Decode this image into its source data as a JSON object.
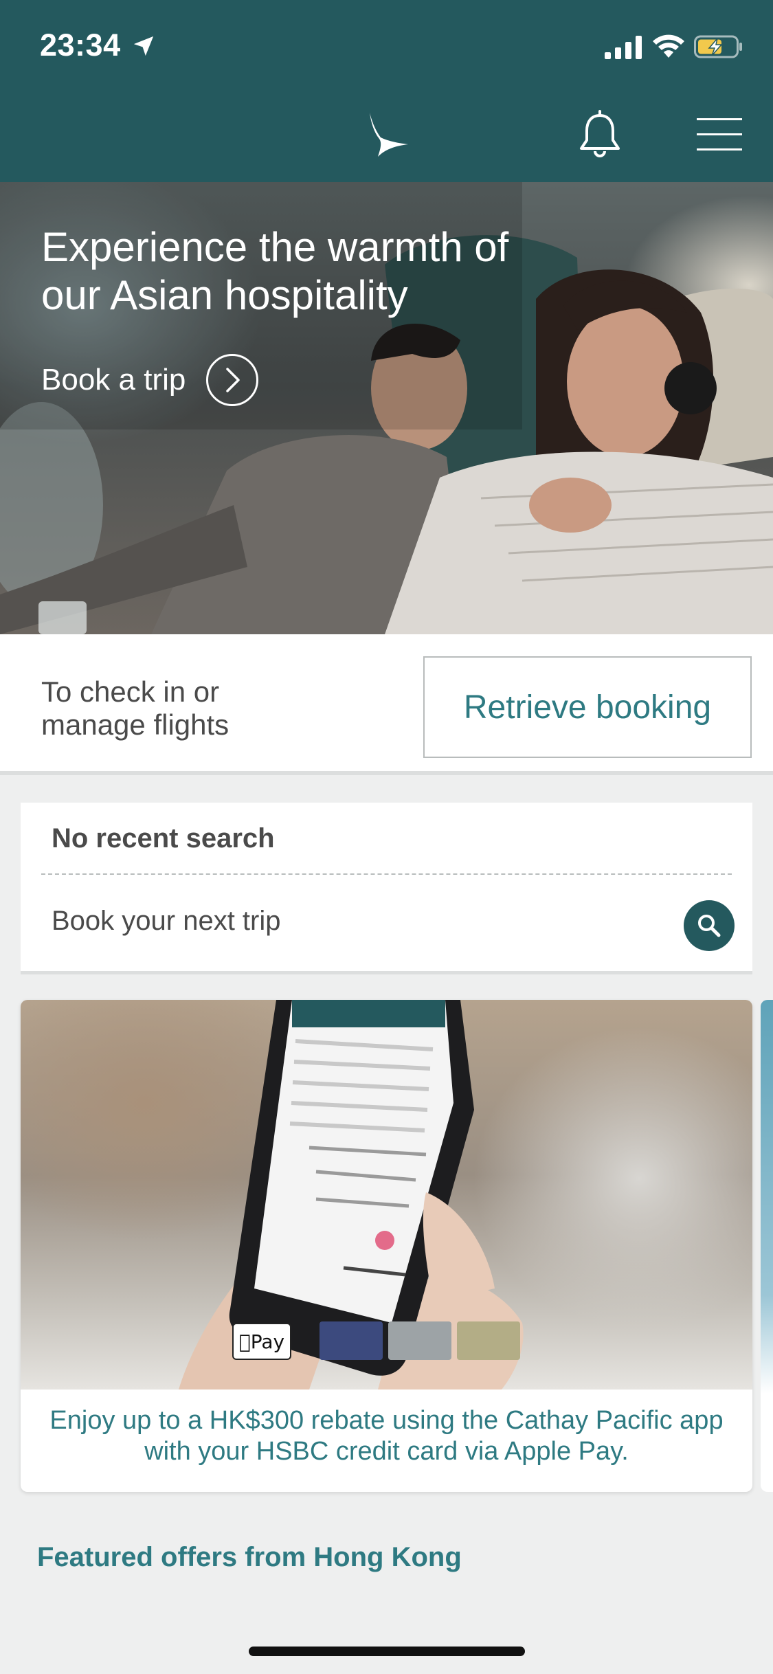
{
  "status_bar": {
    "time": "23:34",
    "icons": [
      "location-arrow-icon",
      "cellular-signal-icon",
      "wifi-icon",
      "battery-charging-icon"
    ]
  },
  "nav": {
    "logo": "cathay-brushwing-logo",
    "icons": [
      "bell-icon",
      "hamburger-menu-icon"
    ],
    "bar_color": "#24595e"
  },
  "hero": {
    "title": "Experience the warmth of our Asian hospitality",
    "cta_label": "Book a trip",
    "cta_icon": "chevron-right-circle-icon"
  },
  "manage": {
    "text": "To check in or manage flights",
    "button_label": "Retrieve booking"
  },
  "search": {
    "recent_label": "No recent search",
    "next_trip_label": "Book your next trip",
    "search_icon": "search-icon"
  },
  "promo": {
    "badge": "Pay",
    "text": "Enjoy up to a HK$300 rebate using the Cathay Pacific app with your HSBC credit card via Apple Pay.",
    "accent": "#2e7a82"
  },
  "featured": {
    "title": "Featured offers from Hong Kong"
  }
}
